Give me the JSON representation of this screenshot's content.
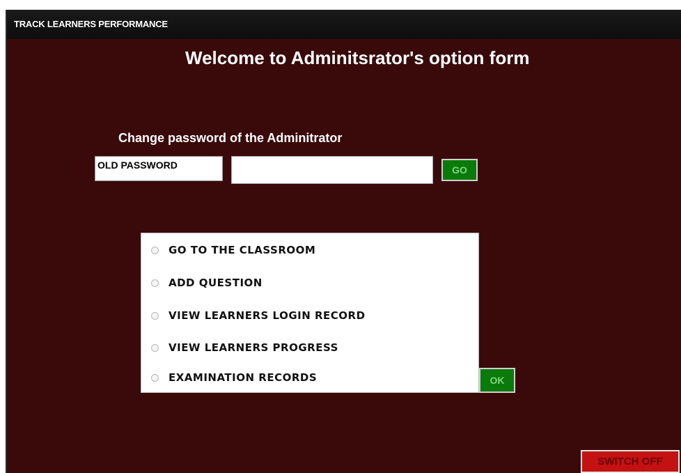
{
  "window": {
    "title": "TRACK LEARNERS PERFORMANCE"
  },
  "form": {
    "heading": "Welcome to Adminitsrator's option form",
    "change_password_label": "Change password of the Adminitrator",
    "old_password_label": "OLD PASSWORD",
    "password_value": "",
    "go_label": "GO"
  },
  "options": {
    "items": [
      {
        "label": "GO TO THE CLASSROOM",
        "selected": false
      },
      {
        "label": "ADD QUESTION",
        "selected": false
      },
      {
        "label": "VIEW LEARNERS LOGIN RECORD",
        "selected": false
      },
      {
        "label": "VIEW LEARNERS PROGRESS",
        "selected": false
      },
      {
        "label": "EXAMINATION RECORDS",
        "selected": false
      }
    ],
    "ok_label": "OK"
  },
  "footer": {
    "switch_off_label": "SWITCH OFF"
  },
  "colors": {
    "background": "#3a0a0b",
    "button_green": "#0a7a0a",
    "button_red": "#c41212"
  }
}
